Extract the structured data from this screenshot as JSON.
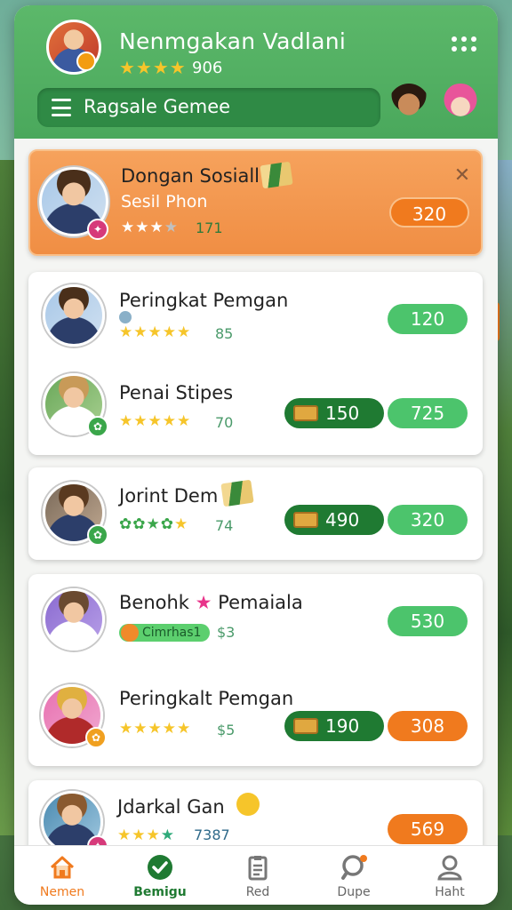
{
  "header": {
    "player_name": "Nenmgakan Vadlani",
    "stars": "★★★★",
    "score": "906",
    "game_select_label": "Ragsale Gemee"
  },
  "featured": {
    "name": "Dongan Sosiall",
    "subtitle": "Sesil Phon",
    "stars": "★★★",
    "rating": "171",
    "value": "320",
    "close_glyph": "✕"
  },
  "rows": [
    {
      "name": "Peringkat Pemgan",
      "rating": "85",
      "value": "120"
    },
    {
      "name": "Penai Stipes",
      "rating": "70",
      "cash": "150",
      "value": "725"
    },
    {
      "name": "Jorint Dem",
      "rating": "74",
      "cash": "490",
      "value": "320"
    },
    {
      "name": "Benohk",
      "name2": "Pemaiala",
      "chips": "Cimrhas1",
      "rating": "$3",
      "value": "530"
    },
    {
      "name": "Peringkalt Pemgan",
      "rating": "$5",
      "cash": "190",
      "value": "308"
    },
    {
      "name": "Jdarkal Gan",
      "rating": "7387",
      "value": "569"
    }
  ],
  "nav": [
    {
      "label": "Nemen",
      "icon": "home-icon"
    },
    {
      "label": "Bemigu",
      "icon": "check-circle-icon"
    },
    {
      "label": "Red",
      "icon": "clipboard-icon"
    },
    {
      "label": "Dupe",
      "icon": "search-icon"
    },
    {
      "label": "Haht",
      "icon": "profile-icon"
    }
  ],
  "colors": {
    "header_green": "#4aa85c",
    "accent_orange": "#f07a1e",
    "pill_green": "#4cc46c",
    "pill_dark_green": "#1f7a32"
  }
}
